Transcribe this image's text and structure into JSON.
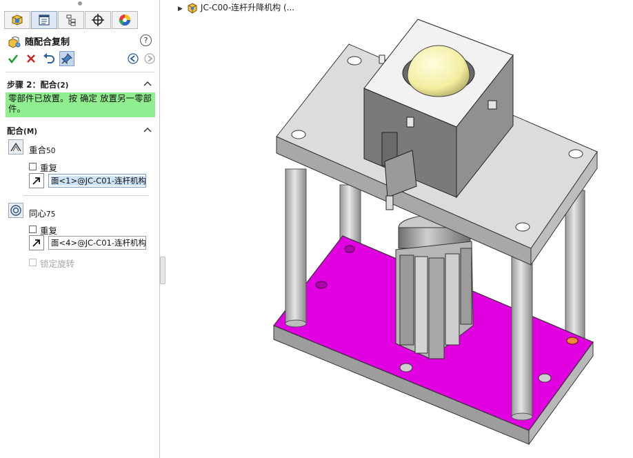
{
  "panel": {
    "tabs": [
      {
        "icon": "feature-manager-icon"
      },
      {
        "icon": "property-manager-icon"
      },
      {
        "icon": "configuration-manager-icon"
      },
      {
        "icon": "dimxpert-icon"
      },
      {
        "icon": "display-manager-icon"
      }
    ],
    "title": "随配合复制",
    "help_label": "?",
    "actions": {
      "ok_icon": "checkmark-icon",
      "cancel_icon": "close-icon",
      "undo_icon": "undo-icon",
      "pushpin_icon": "pushpin-icon",
      "back_icon": "back-arrow-icon",
      "forward_icon": "forward-arrow-icon"
    },
    "step_section": {
      "title": "步骤 2：配合",
      "count": "(2)",
      "message": "零部件已放置。按 确定 放置另一零部件。"
    },
    "mates_section": {
      "title": "配合",
      "shortcut": "(M)",
      "mates": [
        {
          "type_label": "重合",
          "number": "50",
          "icon": "coincident-mate-icon",
          "repeat_label": "重复",
          "selection": "面<1>@JC-C01-连杆机构"
        },
        {
          "type_label": "同心",
          "number": "75",
          "icon": "concentric-mate-icon",
          "repeat_label": "重复",
          "selection": "面<4>@JC-C01-连杆机构"
        }
      ],
      "lock_rotation_label": "锁定旋转"
    }
  },
  "viewport": {
    "doc_title": "JC-C00-连杆升降机构  (...",
    "selected_face_color": "#e000e0",
    "ball_color": "#f3eda0",
    "part_gray": "#c8c8c8"
  }
}
